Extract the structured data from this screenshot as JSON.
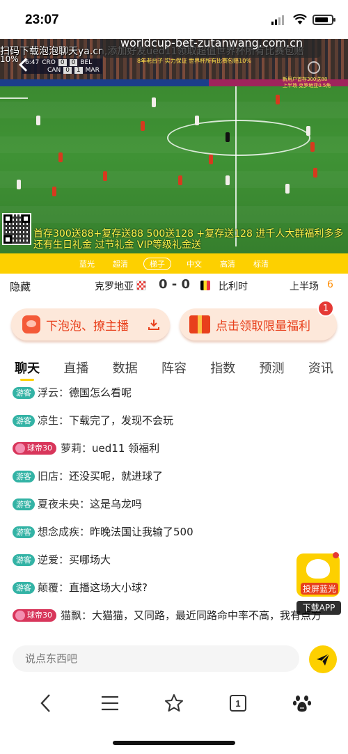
{
  "status_bar": {
    "time": "23:07"
  },
  "video": {
    "url_overlay": "worldcup-bet-zutanwang.com.cn",
    "marquee": "扫码下载泡泡聊天ya.cn,添加好友ued11领取超值世界杯所有比赛包赔",
    "marquee_line2": "10%",
    "promo_top": "8年老台子 实力保证 世界杯所有比赛包赔10%",
    "promo_right_1": "新用户首存300送88",
    "promo_right_2": "上半场 克罗地亚0.5角",
    "scorebug": {
      "clock": "6:47",
      "home_team": "CRO",
      "home_score": "0",
      "away_score": "0",
      "away_team": "BEL",
      "other_home_team": "CAN",
      "other_home_score": "0",
      "other_away_score": "1",
      "other_away_team": "MAR"
    },
    "bottom_ad": "首存300送88+复存送88 500送128 +复存送128 进千人大群福利多多 还有生日礼金 过节礼金 VIP等级礼金送"
  },
  "quality_options": [
    "蓝光",
    "超清",
    "梯子",
    "中文",
    "高清",
    "标清"
  ],
  "quality_selected_index": 2,
  "match": {
    "hide_label": "隐藏",
    "home_team": "克罗地亚",
    "score": "0 - 0",
    "away_team": "比利时",
    "period": "上半场",
    "period_minute": "6"
  },
  "actions": {
    "left_label": "下泡泡、撩主播",
    "right_label": "点击领取限量福利",
    "right_badge": "1"
  },
  "tabs": [
    "聊天",
    "直播",
    "数据",
    "阵容",
    "指数",
    "预测",
    "资讯"
  ],
  "active_tab_index": 0,
  "chat": {
    "guest_tag": "游客",
    "messages": [
      {
        "badge": "游客",
        "nick": "浮云：",
        "text": "德国怎么看呢"
      },
      {
        "badge": "游客",
        "nick": "凉生：",
        "text": "下载完了，发现不会玩"
      },
      {
        "badge": "球帝30",
        "nick": "萝莉：",
        "text": "ued11 领福利"
      },
      {
        "badge": "游客",
        "nick": "旧店：",
        "text": "还没买呢，就进球了"
      },
      {
        "badge": "游客",
        "nick": "夏夜未央：",
        "text": "这是乌龙吗"
      },
      {
        "badge": "游客",
        "nick": "想念成疾：",
        "text": "昨晚法国让我输了500"
      },
      {
        "badge": "游客",
        "nick": "逆爱：",
        "text": "买哪场大"
      },
      {
        "badge": "游客",
        "nick": "颠覆：",
        "text": "直播这场大小球?"
      },
      {
        "badge": "球帝30",
        "nick": "猫飘：",
        "text": "大猫猫，又同路，最近同路命中率不高，我有点方"
      }
    ]
  },
  "float_app": {
    "label": "投屏蓝光",
    "download": "下载APP"
  },
  "input": {
    "placeholder": "说点东西吧"
  },
  "browser_nav": {
    "tab_count": "1"
  },
  "colors": {
    "accent": "#fdd000",
    "orange": "#e8401c",
    "guest_badge": "#33b3a5",
    "vip_badge": "#d8365b"
  },
  "icons": [
    "back-icon",
    "menu-icon",
    "star-icon",
    "tabs-icon",
    "baidu-paw-icon",
    "send-icon",
    "download-icon",
    "gift-icon",
    "bubble-icon"
  ]
}
